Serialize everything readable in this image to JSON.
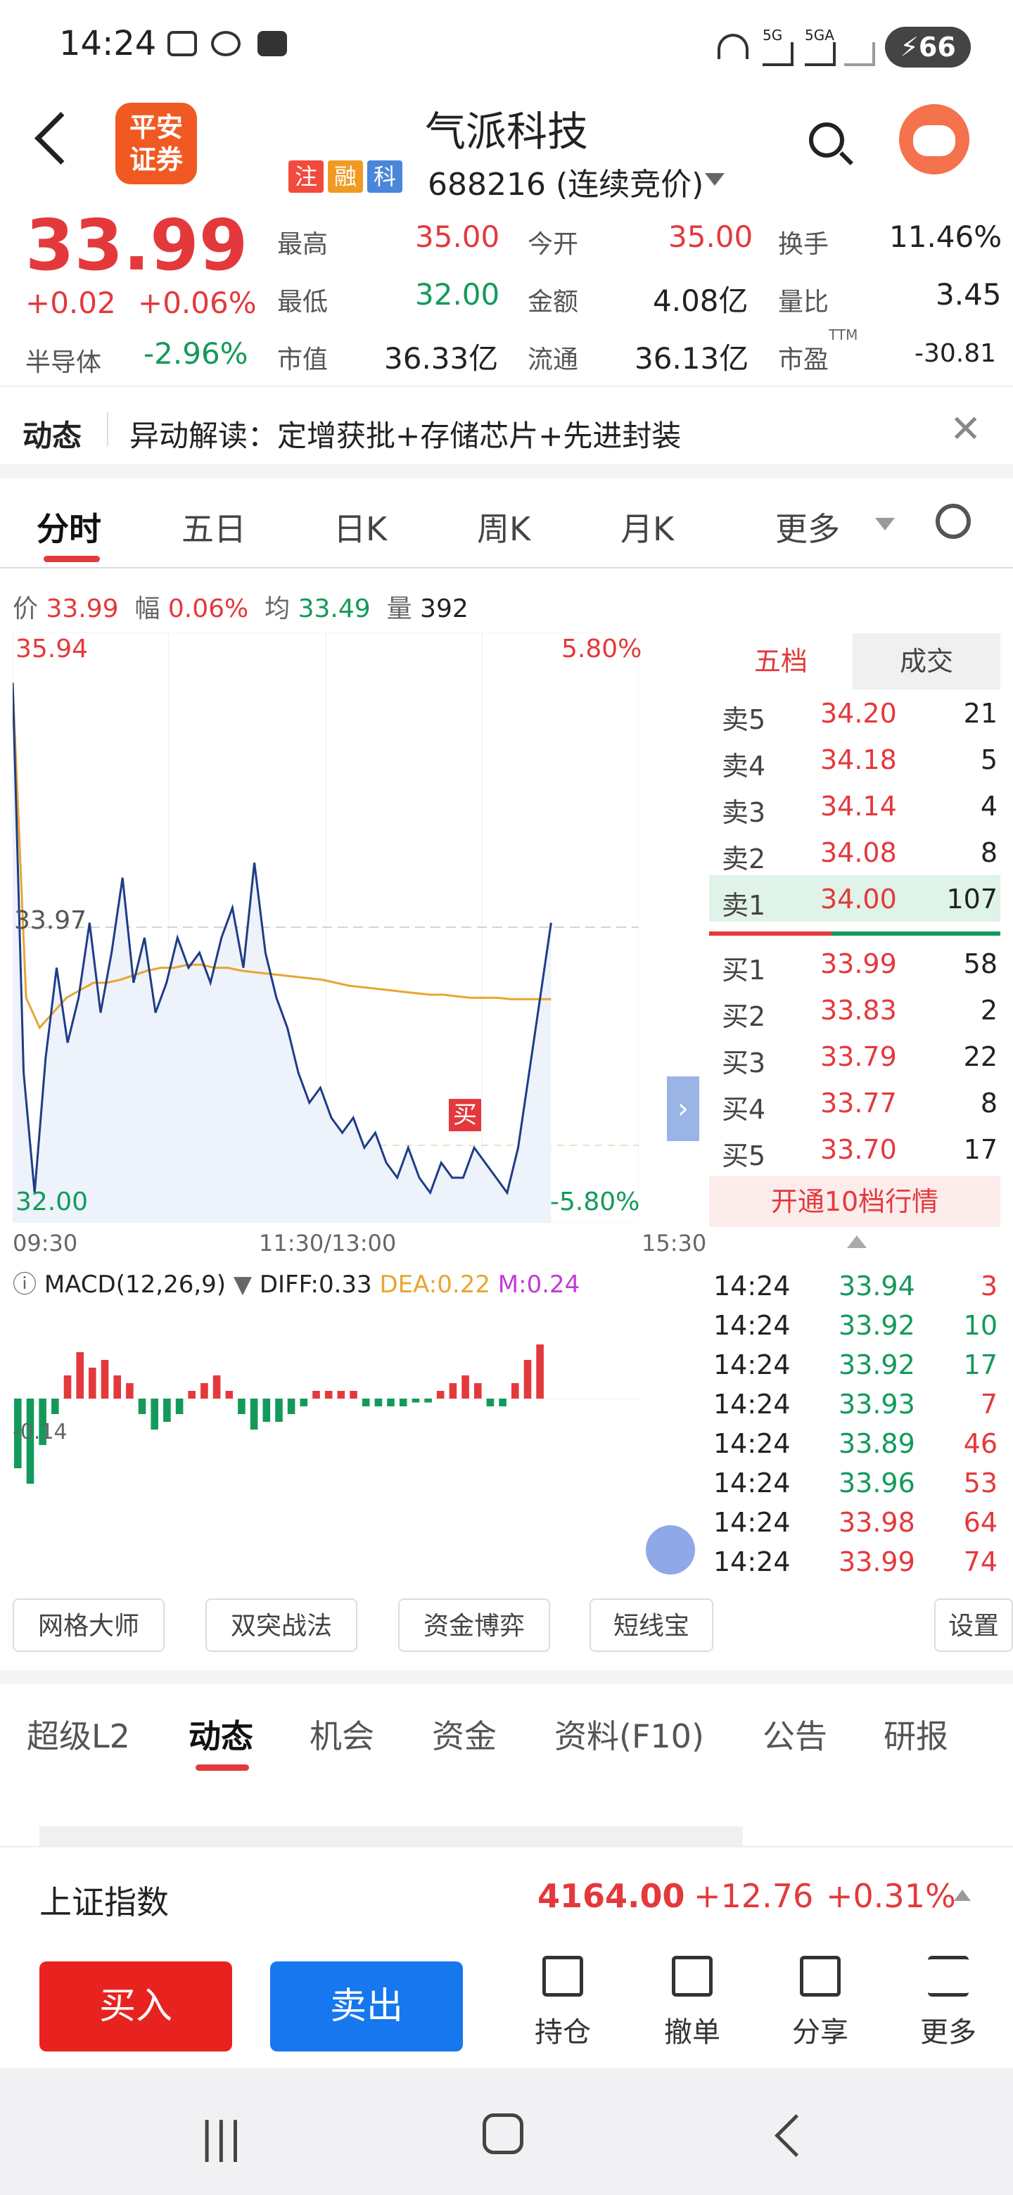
{
  "status": {
    "time": "14:24",
    "net1": "5G",
    "net2": "5GA",
    "battery": "66"
  },
  "header": {
    "name": "气派科技",
    "tags": [
      "注",
      "融",
      "科"
    ],
    "code": "688216 (连续竞价)",
    "logo_line1": "平安",
    "logo_line2": "证券"
  },
  "quote": {
    "price": "33.99",
    "change": "+0.02",
    "change_pct": "+0.06%",
    "sector": "半导体",
    "sector_pct": "-2.96%",
    "high_label": "最高",
    "high": "35.00",
    "low_label": "最低",
    "low": "32.00",
    "mcap_label": "市值",
    "mcap": "36.33亿",
    "open_label": "今开",
    "open": "35.00",
    "amount_label": "金额",
    "amount": "4.08亿",
    "float_label": "流通",
    "float": "36.13亿",
    "turnover_label": "换手",
    "turnover": "11.46%",
    "volratio_label": "量比",
    "volratio": "3.45",
    "pe_label": "市盈",
    "pe_sup": "TTM",
    "pe": "-30.81"
  },
  "news": {
    "label": "动态",
    "text": "异动解读：定增获批+存储芯片+先进封装"
  },
  "tabs": [
    "分时",
    "五日",
    "日K",
    "周K",
    "月K",
    "更多"
  ],
  "infoline": {
    "price_label": "价",
    "price": "33.99",
    "amp_label": "幅",
    "amp": "0.06%",
    "avg_label": "均",
    "avg": "33.49",
    "vol_label": "量",
    "vol": "392"
  },
  "chart_data": {
    "type": "line",
    "title": "",
    "y_top_left": "35.94",
    "y_bottom_left": "32.00",
    "ref_price": "33.97",
    "y_top_right": "5.80%",
    "y_bottom_right": "-5.80%",
    "ylim": [
      32.0,
      35.94
    ],
    "x_labels": [
      "09:30",
      "11:30/13:00",
      "15:30"
    ],
    "series": [
      {
        "values": [
          35.6,
          33.0,
          32.2,
          33.1,
          33.7,
          33.2,
          33.5,
          34.0,
          33.4,
          33.8,
          34.3,
          33.6,
          33.9,
          33.4,
          33.6,
          33.9,
          33.7,
          33.8,
          33.6,
          33.9,
          34.1,
          33.7,
          34.4,
          33.8,
          33.5,
          33.3,
          33.0,
          32.8,
          32.9,
          32.7,
          32.6,
          32.7,
          32.5,
          32.6,
          32.4,
          32.3,
          32.5,
          32.3,
          32.2,
          32.4,
          32.3,
          32.3,
          32.5,
          32.4,
          32.3,
          32.2,
          32.5,
          33.0,
          33.5,
          34.0
        ]
      },
      {
        "values": [
          35.6,
          33.5,
          33.3,
          33.4,
          33.5,
          33.55,
          33.6,
          33.6,
          33.62,
          33.65,
          33.68,
          33.7,
          33.7,
          33.72,
          33.72,
          33.7,
          33.7,
          33.68,
          33.67,
          33.66,
          33.65,
          33.64,
          33.63,
          33.62,
          33.6,
          33.58,
          33.57,
          33.56,
          33.55,
          33.54,
          33.53,
          33.52,
          33.52,
          33.51,
          33.5,
          33.5,
          33.5,
          33.49,
          33.49,
          33.49,
          33.49
        ]
      }
    ],
    "buy_marker": "买"
  },
  "macd": {
    "label": "MACD(12,26,9)",
    "diff": "DIFF:0.33",
    "dea": "DEA:0.22",
    "m": "M:0.24",
    "axis": "-0.14",
    "hist": [
      -0.9,
      -1.1,
      -0.6,
      -0.2,
      0.3,
      0.6,
      0.4,
      0.5,
      0.3,
      0.2,
      -0.2,
      -0.4,
      -0.3,
      -0.2,
      0.1,
      0.2,
      0.3,
      0.1,
      -0.2,
      -0.4,
      -0.3,
      -0.3,
      -0.2,
      -0.1,
      0.1,
      0.1,
      0.1,
      0.1,
      -0.1,
      -0.1,
      -0.1,
      -0.1,
      -0.05,
      -0.05,
      0.1,
      0.2,
      0.3,
      0.2,
      -0.1,
      -0.1,
      0.2,
      0.5,
      0.7
    ]
  },
  "orderbook": {
    "tab_active": "五档",
    "tab_other": "成交",
    "asks": [
      [
        "卖5",
        "34.20",
        "21"
      ],
      [
        "卖4",
        "34.18",
        "5"
      ],
      [
        "卖3",
        "34.14",
        "4"
      ],
      [
        "卖2",
        "34.08",
        "8"
      ],
      [
        "卖1",
        "34.00",
        "107"
      ]
    ],
    "bids": [
      [
        "买1",
        "33.99",
        "58"
      ],
      [
        "买2",
        "33.83",
        "2"
      ],
      [
        "买3",
        "33.79",
        "22"
      ],
      [
        "买4",
        "33.77",
        "8"
      ],
      [
        "买5",
        "33.70",
        "17"
      ]
    ],
    "open_btn": "开通10档行情"
  },
  "trades": [
    [
      "14:24",
      "33.94",
      "3"
    ],
    [
      "14:24",
      "33.92",
      "10"
    ],
    [
      "14:24",
      "33.92",
      "17"
    ],
    [
      "14:24",
      "33.93",
      "7"
    ],
    [
      "14:24",
      "33.89",
      "46"
    ],
    [
      "14:24",
      "33.96",
      "53"
    ],
    [
      "14:24",
      "33.98",
      "64"
    ],
    [
      "14:24",
      "33.99",
      "74"
    ]
  ],
  "tools": [
    "网格大师",
    "双突战法",
    "资金博弈",
    "短线宝",
    "设置"
  ],
  "bottom_tabs": [
    "超级L2",
    "动态",
    "机会",
    "资金",
    "资料(F10)",
    "公告",
    "研报"
  ],
  "index": {
    "name": "上证指数",
    "value": "4164.00",
    "change": "+12.76",
    "pct": "+0.31%"
  },
  "actions": {
    "buy": "买入",
    "sell": "卖出",
    "hold": "持仓",
    "cancel": "撤单",
    "share": "分享",
    "more": "更多"
  },
  "colors": {
    "up": "#e4393c",
    "down": "#139a5b",
    "price_line": "#1f3c88",
    "avg_line": "#e8a530",
    "buy_btn": "#e8231f",
    "sell_btn": "#1677ee"
  }
}
